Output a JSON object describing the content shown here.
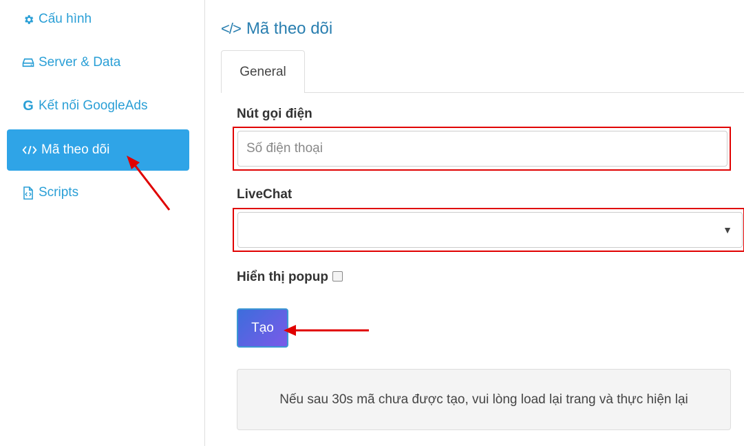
{
  "sidebar": {
    "items": [
      {
        "label": "Cấu hình",
        "icon": "gear-icon"
      },
      {
        "label": "Server & Data",
        "icon": "hard-drive-icon"
      },
      {
        "label": "Kết nối GoogleAds",
        "icon": "google-icon"
      },
      {
        "label": "Mã theo dõi",
        "icon": "code-icon",
        "active": true
      },
      {
        "label": "Scripts",
        "icon": "file-code-icon"
      }
    ]
  },
  "main": {
    "title": "Mã theo dõi",
    "title_icon": "</>",
    "tabs": [
      {
        "label": "General",
        "active": true
      }
    ],
    "form": {
      "call_button_label": "Nút gọi điện",
      "phone_placeholder": "Số điện thoại",
      "phone_value": "",
      "livechat_label": "LiveChat",
      "livechat_selected": "",
      "popup_label": "Hiển thị popup",
      "popup_checked": false,
      "create_button_label": "Tạo"
    },
    "notice": "Nếu sau 30s mã chưa được tạo, vui lòng load lại trang và thực hiện lại"
  },
  "colors": {
    "accent": "#2fa4e7",
    "link": "#2a9fd6",
    "annotation_red": "#e00000",
    "button_gradient_start": "#3d6ddc",
    "button_gradient_end": "#7a5ae8"
  }
}
